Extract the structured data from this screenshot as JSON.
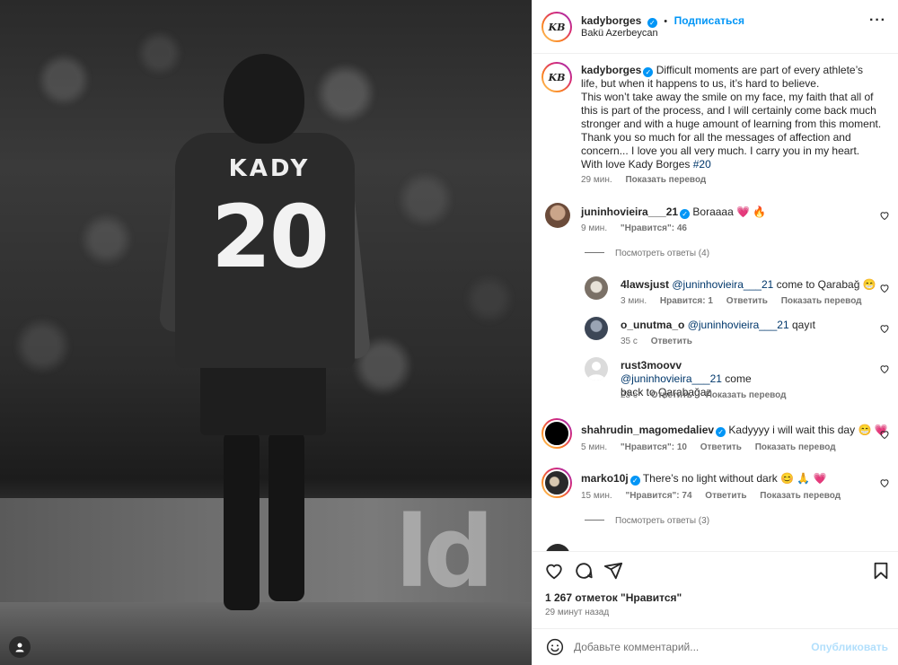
{
  "photo": {
    "jersey_name": "KADY",
    "jersey_number": "20",
    "board_text": "ld"
  },
  "header": {
    "avatar_initials": "KB",
    "username": "kadyborges",
    "separator": "•",
    "follow_label": "Подписаться",
    "location": "Bakü Azerbeycan"
  },
  "caption": {
    "username": "kadyborges",
    "text": "Difficult moments are part of every athlete’s life, but when it happens to us, it’s hard to believe.\nThis won’t take away the smile on my face, my faith that all of this is part of the process, and I will certainly come back much stronger and with a huge amount of learning from this moment.\nThank you so much for all the messages of affection and concern... I love you all very much. I carry you in my heart.\nWith love Kady Borges",
    "hashtag": "#20",
    "time": "29 мин.",
    "translate": "Показать перевод"
  },
  "comments": [
    {
      "username": "juninhovieira___21",
      "verified": true,
      "text": "Boraaaa 💗 🔥",
      "time": "9 мин.",
      "likes": "\"Нравится\": 46",
      "translate": "",
      "reply_label": "",
      "view_replies": "Посмотреть ответы (4)",
      "replies": [
        {
          "username": "4lawsjust",
          "mention": "@juninhovieira___21",
          "text": "come to Qarabağ 😁",
          "time": "3 мин.",
          "likes": "Нравится: 1",
          "reply_label": "Ответить",
          "translate": "Показать перевод"
        },
        {
          "username": "o_unutma_o",
          "mention": "@juninhovieira___21",
          "text": "qayıt",
          "time": "35 с",
          "likes": "",
          "reply_label": "Ответить",
          "translate": ""
        },
        {
          "username": "rust3moovv",
          "mention": "@juninhovieira___21",
          "text": "come back to Qarabağaz",
          "time": "23 с",
          "likes": "",
          "reply_label": "Ответить",
          "translate": "Показать перевод"
        }
      ]
    },
    {
      "username": "shahrudin_magomedaliev",
      "verified": true,
      "text": "Kadyyyy i will wait this day 😁 💗",
      "time": "5 мин.",
      "likes": "\"Нравится\": 10",
      "reply_label": "Ответить",
      "translate": "Показать перевод"
    },
    {
      "username": "marko10j",
      "verified": true,
      "text": "There’s no light without dark 😊 🙏 💗",
      "time": "15 мин.",
      "likes": "\"Нравится\": 74",
      "reply_label": "Ответить",
      "translate": "Показать перевод",
      "view_replies": "Посмотреть ответы (3)"
    }
  ],
  "footer": {
    "likes": "1 267 отметок \"Нравится\"",
    "time_ago": "29 минут назад",
    "comment_placeholder": "Добавьте комментарий...",
    "post_label": "Опубликовать"
  },
  "colors": {
    "accent": "#0095f6",
    "link": "#00376b",
    "muted": "#737373",
    "heart": "#e1306c"
  }
}
